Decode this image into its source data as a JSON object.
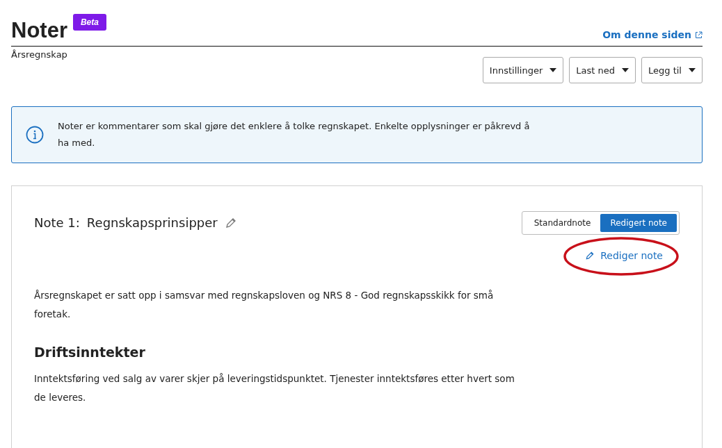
{
  "header": {
    "title": "Noter",
    "badge": "Beta",
    "link": "Om denne siden",
    "subtitle": "Årsregnskap"
  },
  "actions": [
    {
      "label": "Innstillinger"
    },
    {
      "label": "Last ned"
    },
    {
      "label": "Legg til"
    }
  ],
  "info": {
    "text": "Noter er kommentarer som skal gjøre det enklere å tolke regnskapet. Enkelte opplysninger er påkrevd å ha med."
  },
  "note": {
    "number": "Note 1:",
    "title": "Regnskapsprinsipper",
    "toggle": [
      {
        "label": "Standardnote",
        "selected": false
      },
      {
        "label": "Redigert note",
        "selected": true
      }
    ],
    "edit_link": "Rediger note",
    "highlighted": true,
    "blocks": [
      {
        "kind": "paragraph",
        "text": "Årsregnskapet er satt opp i samsvar med regnskapsloven og NRS 8 - God regnskapsskikk for små foretak."
      },
      {
        "kind": "heading",
        "text": "Driftsinntekter"
      },
      {
        "kind": "paragraph",
        "text": "Inntektsføring ved salg av varer skjer på leveringstidspunktet. Tjenester inntektsføres etter hvert som de leveres."
      }
    ]
  }
}
